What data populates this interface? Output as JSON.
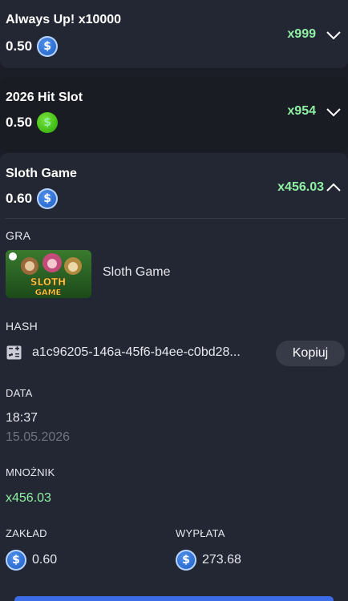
{
  "rows": [
    {
      "title": "Always Up! x10000",
      "amount": "0.50",
      "currency_icon": "usdc-coin-icon",
      "multiplier": "x999",
      "expanded": false
    },
    {
      "title": "2026 Hit Slot",
      "amount": "0.50",
      "currency_icon": "dollar-coin-icon",
      "multiplier": "x954",
      "expanded": false
    },
    {
      "title": "Sloth Game",
      "amount": "0.60",
      "currency_icon": "usdc-coin-icon",
      "multiplier": "x456.03",
      "expanded": true
    }
  ],
  "details": {
    "game_label": "GRA",
    "game_name": "Sloth Game",
    "game_thumb_text": "SLOTH GAME",
    "hash_label": "HASH",
    "hash_value": "a1c96205-146a-45f6-b4ee-c0bd28...",
    "copy_label": "Kopiuj",
    "date_label": "DATA",
    "time": "18:37",
    "date": "15.05.2026",
    "multiplier_label": "MNOŻNIK",
    "multiplier_value": "x456.03",
    "bet_label": "ZAKŁAD",
    "bet_value": "0.60",
    "payout_label": "WYPŁATA",
    "payout_value": "273.68"
  },
  "colors": {
    "background": "#1b1e27",
    "card": "#232733",
    "multiplier_green": "#8ff0a4",
    "usdc_blue": "#2e6fd3",
    "dollar_green": "#46c21a",
    "button_bg": "#373b48"
  }
}
